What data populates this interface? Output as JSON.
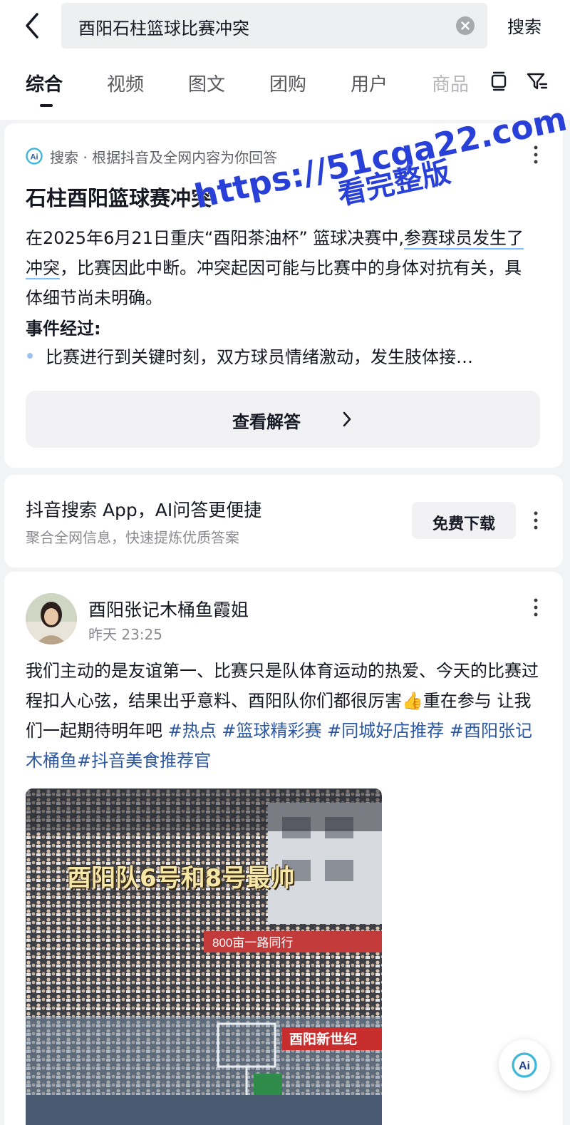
{
  "search": {
    "query": "酉阳石柱篮球比赛冲突",
    "submit_label": "搜索"
  },
  "tabs": [
    {
      "label": "综合",
      "active": true
    },
    {
      "label": "视频"
    },
    {
      "label": "图文"
    },
    {
      "label": "团购"
    },
    {
      "label": "用户"
    },
    {
      "label": "商品"
    }
  ],
  "ai_answer": {
    "source_label": "搜索 · 根据抖音及全网内容为你回答",
    "title": "石柱酉阳篮球赛冲突",
    "body_part1": "在2025年6月21日重庆“酉阳茶油杯” 篮球决赛中,",
    "body_highlight": "参赛球员发生了冲突",
    "body_part2": "，比赛因此中断。冲突起因可能与比赛中的身体对抗有关，具体细节尚未明确。",
    "section_title": "事件经过:",
    "bullet": "比赛进行到关键时刻，双方球员情绪激动，发生肢体接…",
    "view_label": "查看解答",
    "logo_text": "Ai"
  },
  "app_promo": {
    "title": "抖音搜索 App，AI问答更便捷",
    "subtitle": "聚合全网信息，快速提炼优质答案",
    "download_label": "免费下载"
  },
  "post": {
    "author": "酉阳张记木桶鱼霞姐",
    "time": "昨天 23:25",
    "text_main": "我们主动的是友谊第一、比赛只是队体育运动的热爱、今天的比赛过程扣人心弦，结果出乎意料、酉阳队你们都很厉害",
    "thumb_emoji": "👍",
    "text_after": "重在参与 让我们一起期待明年吧 ",
    "tags": [
      "#热点",
      "#篮球精彩赛",
      "#同城好店推荐",
      "#酉阳张记木桶鱼",
      "#抖音美食推荐官"
    ],
    "image_caption": "酉阳队6号和8号最帅",
    "image_banner_1": "800亩一路同行",
    "image_banner_2": "酉阳新世纪"
  },
  "watermark": {
    "line1": "https://51cga22.com",
    "line2": "看完整版"
  },
  "floating_button": {
    "label": "Ai"
  },
  "colors": {
    "accent_blue": "#2b57a3",
    "watermark_blue": "#2840d8",
    "background": "#f2f3f5"
  }
}
